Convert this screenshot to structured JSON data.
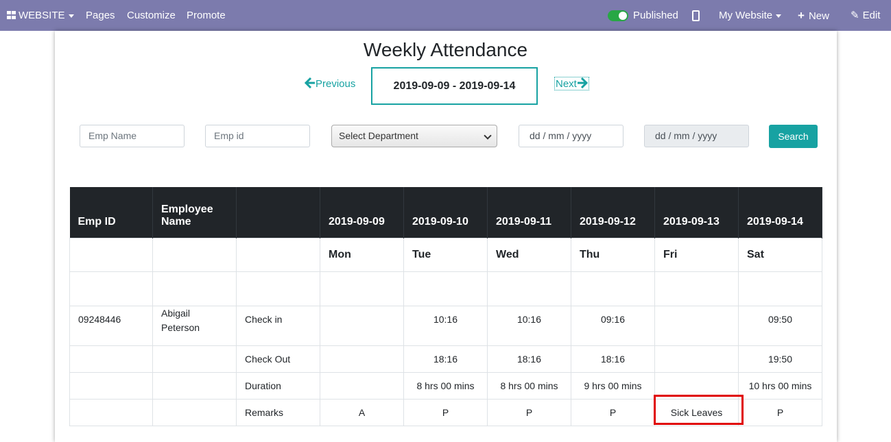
{
  "topbar": {
    "website": "WEBSITE",
    "pages": "Pages",
    "customize": "Customize",
    "promote": "Promote",
    "published": "Published",
    "my_website": "My Website",
    "new": "New",
    "edit": "Edit"
  },
  "title": "Weekly Attendance",
  "nav": {
    "previous": "Previous",
    "next": "Next",
    "range": "2019-09-09 - 2019-09-14"
  },
  "filters": {
    "emp_name_placeholder": "Emp Name",
    "emp_id_placeholder": "Emp id",
    "department": "Select Department",
    "date_from_placeholder": "dd / mm / yyyy",
    "date_to_placeholder": "dd / mm / yyyy",
    "search": "Search"
  },
  "table": {
    "headers": [
      "Emp ID",
      "Employee Name",
      "",
      "2019-09-09",
      "2019-09-10",
      "2019-09-11",
      "2019-09-12",
      "2019-09-13",
      "2019-09-14"
    ],
    "days": [
      "Mon",
      "Tue",
      "Wed",
      "Thu",
      "Fri",
      "Sat"
    ],
    "employee": {
      "id": "09248446",
      "name": "Abigail Peterson",
      "rows": [
        {
          "label": "Check in",
          "values": [
            "",
            "10:16",
            "10:16",
            "09:16",
            "",
            "09:50"
          ]
        },
        {
          "label": "Check Out",
          "values": [
            "",
            "18:16",
            "18:16",
            "18:16",
            "",
            "19:50"
          ]
        },
        {
          "label": "Duration",
          "values": [
            "",
            "8 hrs 00 mins",
            "8 hrs 00 mins",
            "9 hrs 00 mins",
            "",
            "10 hrs 00 mins"
          ]
        },
        {
          "label": "Remarks",
          "values": [
            "A",
            "P",
            "P",
            "P",
            "Sick Leaves",
            "P"
          ]
        }
      ]
    }
  },
  "colors": {
    "topbar": "#7c7bad",
    "accent": "#17a2a2",
    "table_header": "#212529",
    "highlight": "#e00000"
  }
}
